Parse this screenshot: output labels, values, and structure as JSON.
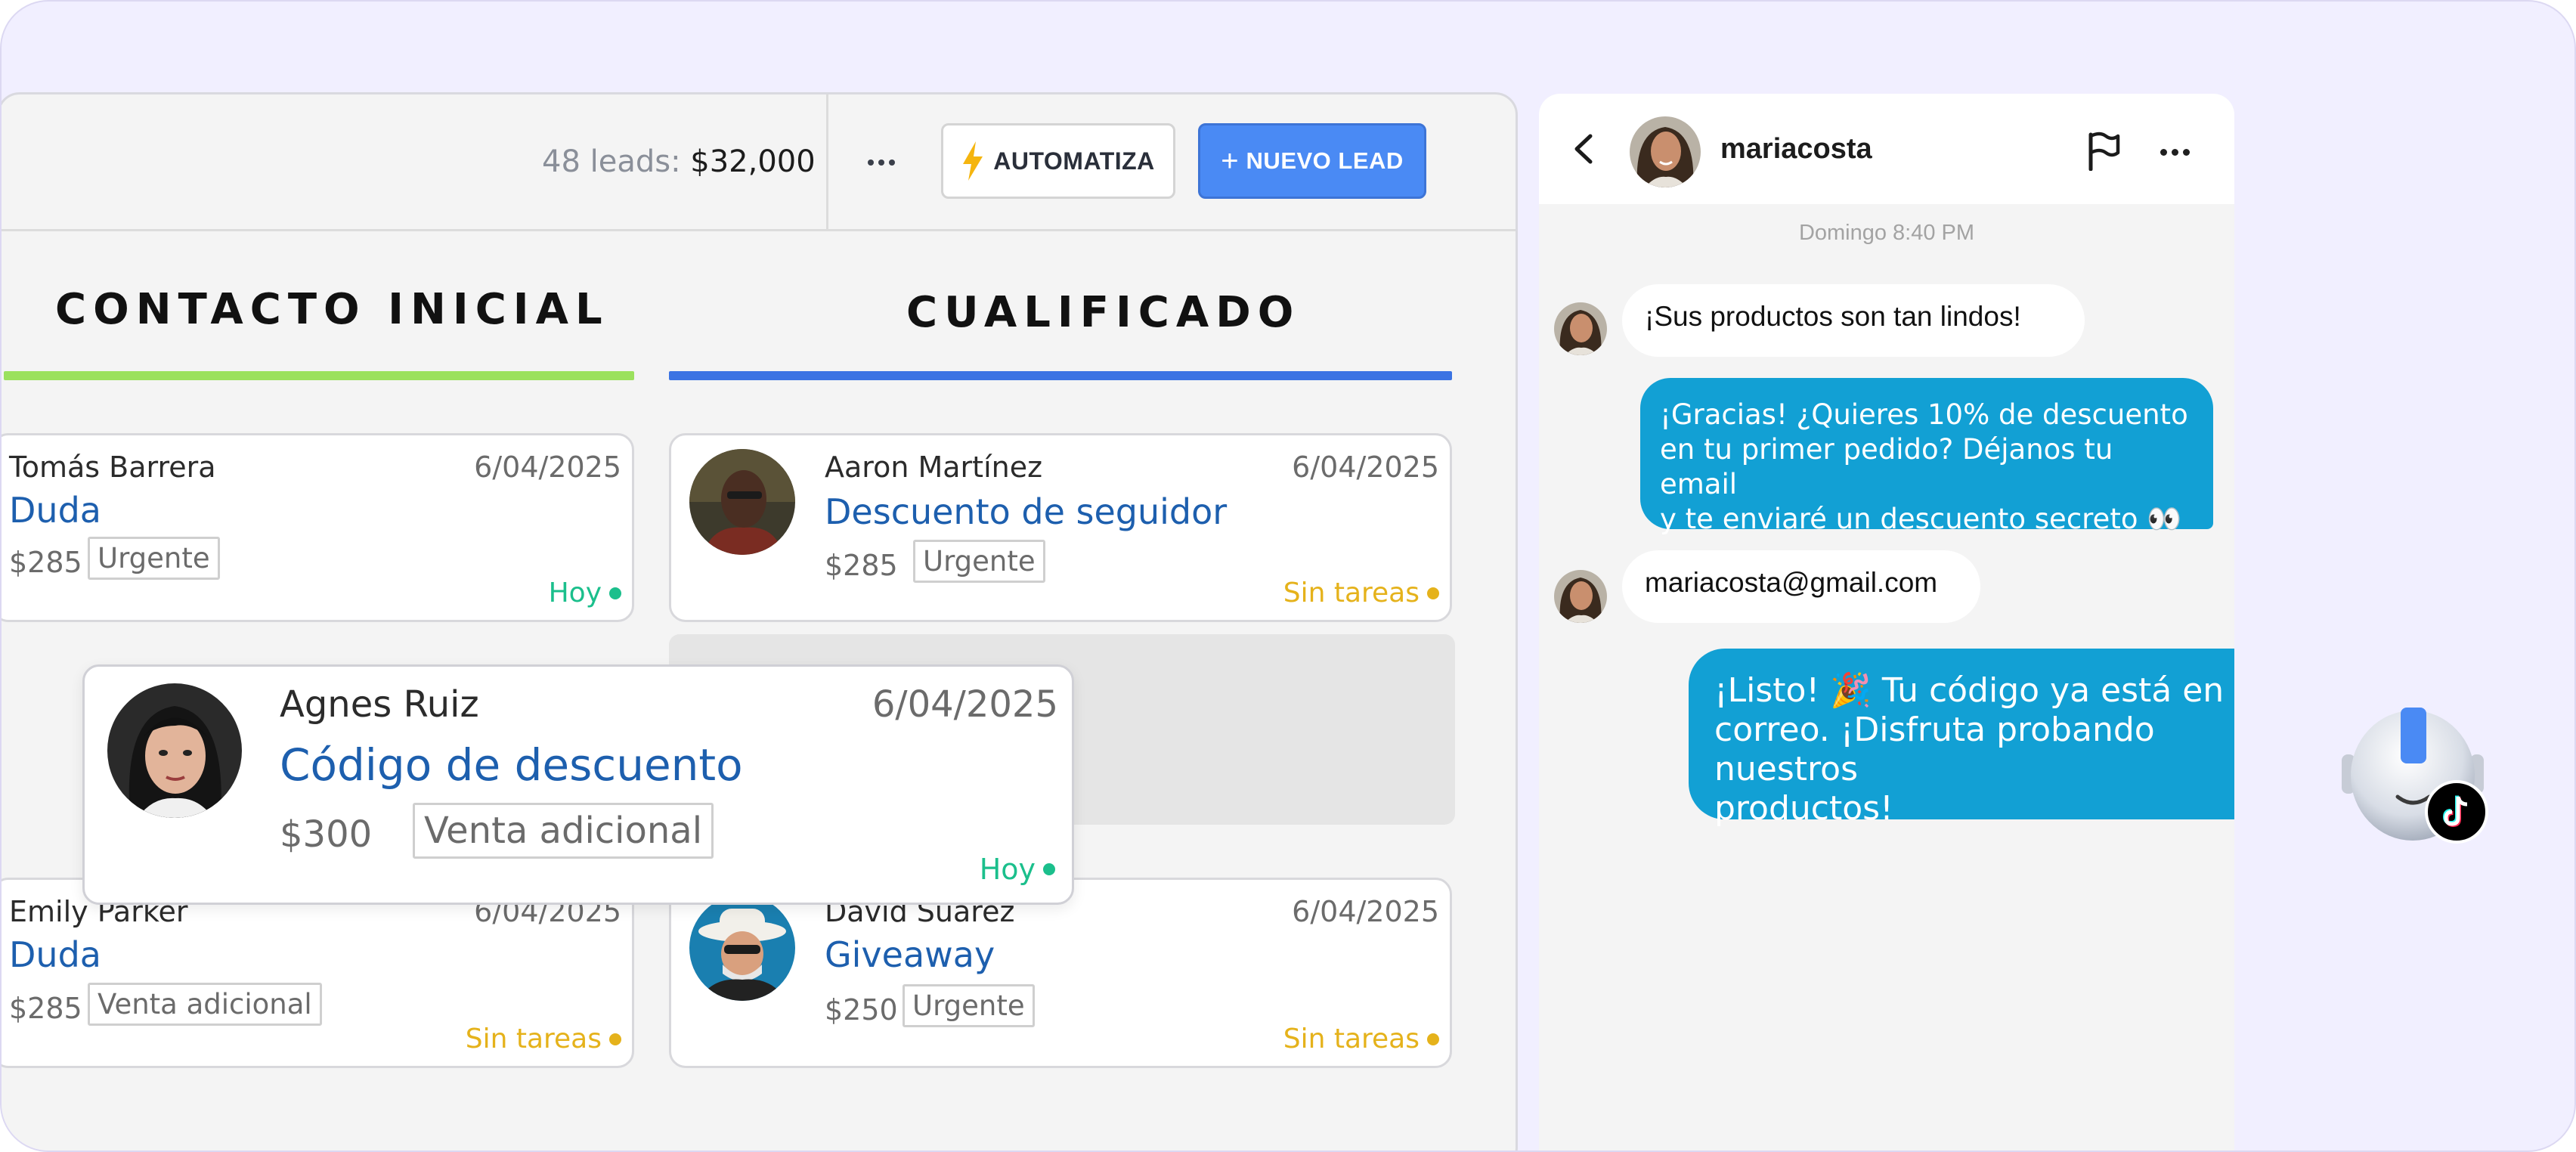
{
  "toolbar": {
    "leads_label": "48 leads:",
    "leads_amount": "$32,000",
    "more_icon": "ellipsis-icon",
    "automate_label": "AUTOMATIZA",
    "automate_icon": "lightning-bolt-icon",
    "new_lead_plus": "+",
    "new_lead_label": "NUEVO LEAD"
  },
  "columns": [
    {
      "title": "CONTACTO INICIAL",
      "color": "#9be15d"
    },
    {
      "title": "CUALIFICADO",
      "color": "#3b73e3"
    }
  ],
  "cards": {
    "tomas": {
      "name": "Tomás Barrera",
      "date": "6/04/2025",
      "subject": "Duda",
      "price": "$285",
      "tag": "Urgente",
      "status": "Hoy"
    },
    "aaron": {
      "name": "Aaron Martínez",
      "date": "6/04/2025",
      "subject": "Descuento de seguidor",
      "price": "$285",
      "tag": "Urgente",
      "status": "Sin tareas"
    },
    "agnes": {
      "name": "Agnes Ruiz",
      "date": "6/04/2025",
      "subject": "Código de descuento",
      "price": "$300",
      "tag": "Venta adicional",
      "status": "Hoy"
    },
    "emily": {
      "name": "Emily Parker",
      "date": "6/04/2025",
      "subject": "Duda",
      "price": "$285",
      "tag": "Venta adicional",
      "status": "Sin tareas"
    },
    "david": {
      "name": "David Suarez",
      "date": "6/04/2025",
      "subject": "Giveaway",
      "price": "$250",
      "tag": "Urgente",
      "status": "Sin tareas"
    }
  },
  "status_colors": {
    "today": "#1bbf8c",
    "no_tasks": "#e5b21b"
  },
  "chat": {
    "username": "mariacosta",
    "timestamp": "Domingo 8:40 PM",
    "messages": [
      {
        "dir": "in",
        "text": "¡Sus productos son tan lindos!"
      },
      {
        "dir": "out",
        "lines": [
          "¡Gracias! ¿Quieres 10% de descuento",
          "en tu primer pedido? Déjanos tu email",
          "y te enviaré un descuento secreto 👀"
        ]
      },
      {
        "dir": "in",
        "text": "mariacosta@gmail.com"
      },
      {
        "dir": "out",
        "lines": [
          "¡Listo! 🎉 Tu código ya está en tu",
          "correo. ¡Disfruta probando nuestros",
          "productos!"
        ]
      }
    ],
    "accent_color": "#12a0d4",
    "bot_icon": "robot-avatar-icon",
    "platform_icon": "tiktok-icon"
  }
}
